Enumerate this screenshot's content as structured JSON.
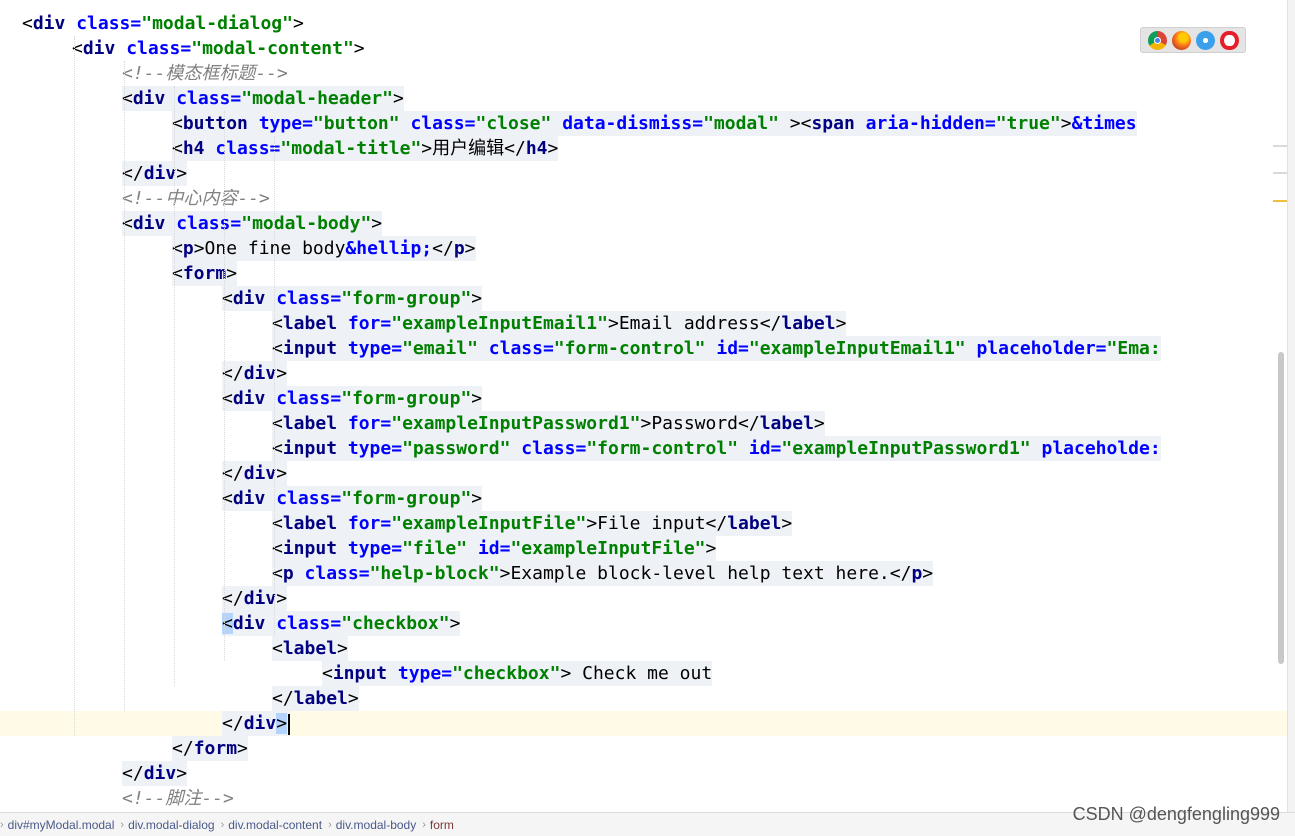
{
  "editor": {
    "lines": [
      {
        "indent": 0,
        "segs": [
          {
            "t": "<",
            "c": "brk"
          },
          {
            "t": "div",
            "c": "tag"
          },
          {
            "t": " ",
            "c": "txt"
          },
          {
            "t": "class=",
            "c": "attr"
          },
          {
            "t": "\"modal-dialog\"",
            "c": "val"
          },
          {
            "t": ">",
            "c": "brk"
          }
        ]
      },
      {
        "indent": 1,
        "segs": [
          {
            "t": "<",
            "c": "brk"
          },
          {
            "t": "div",
            "c": "tag"
          },
          {
            "t": " ",
            "c": "txt"
          },
          {
            "t": "class=",
            "c": "attr"
          },
          {
            "t": "\"modal-content\"",
            "c": "val"
          },
          {
            "t": ">",
            "c": "brk"
          }
        ]
      },
      {
        "indent": 2,
        "segs": [
          {
            "t": "<!--模态框标题-->",
            "c": "cmt"
          }
        ]
      },
      {
        "indent": 2,
        "segs": [
          {
            "t": "<",
            "c": "brk"
          },
          {
            "t": "div",
            "c": "tag"
          },
          {
            "t": " ",
            "c": "txt"
          },
          {
            "t": "class=",
            "c": "attr"
          },
          {
            "t": "\"modal-header\"",
            "c": "val"
          },
          {
            "t": ">",
            "c": "brk"
          }
        ]
      },
      {
        "indent": 3,
        "segs": [
          {
            "t": "<",
            "c": "brk"
          },
          {
            "t": "button",
            "c": "tag"
          },
          {
            "t": " ",
            "c": "txt"
          },
          {
            "t": "type=",
            "c": "attr"
          },
          {
            "t": "\"button\"",
            "c": "val"
          },
          {
            "t": " ",
            "c": "txt"
          },
          {
            "t": "class=",
            "c": "attr"
          },
          {
            "t": "\"close\"",
            "c": "val"
          },
          {
            "t": " ",
            "c": "txt"
          },
          {
            "t": "data-dismiss=",
            "c": "attr"
          },
          {
            "t": "\"modal\"",
            "c": "val"
          },
          {
            "t": " ><",
            "c": "brk"
          },
          {
            "t": "span",
            "c": "tag"
          },
          {
            "t": " ",
            "c": "txt"
          },
          {
            "t": "aria-hidden=",
            "c": "attr"
          },
          {
            "t": "\"true\"",
            "c": "val"
          },
          {
            "t": ">",
            "c": "brk"
          },
          {
            "t": "&times",
            "c": "ent"
          }
        ]
      },
      {
        "indent": 3,
        "segs": [
          {
            "t": "<",
            "c": "brk"
          },
          {
            "t": "h4",
            "c": "tag"
          },
          {
            "t": " ",
            "c": "txt"
          },
          {
            "t": "class=",
            "c": "attr"
          },
          {
            "t": "\"modal-title\"",
            "c": "val"
          },
          {
            "t": ">",
            "c": "brk"
          },
          {
            "t": "用户编辑",
            "c": "txt"
          },
          {
            "t": "</",
            "c": "brk"
          },
          {
            "t": "h4",
            "c": "tag"
          },
          {
            "t": ">",
            "c": "brk"
          }
        ]
      },
      {
        "indent": 2,
        "segs": [
          {
            "t": "</",
            "c": "brk"
          },
          {
            "t": "div",
            "c": "tag"
          },
          {
            "t": ">",
            "c": "brk"
          }
        ]
      },
      {
        "indent": 2,
        "segs": [
          {
            "t": "<!--中心内容-->",
            "c": "cmt"
          }
        ]
      },
      {
        "indent": 2,
        "segs": [
          {
            "t": "<",
            "c": "brk"
          },
          {
            "t": "div",
            "c": "tag"
          },
          {
            "t": " ",
            "c": "txt"
          },
          {
            "t": "class=",
            "c": "attr"
          },
          {
            "t": "\"modal-body\"",
            "c": "val"
          },
          {
            "t": ">",
            "c": "brk"
          }
        ]
      },
      {
        "indent": 3,
        "segs": [
          {
            "t": "<",
            "c": "brk"
          },
          {
            "t": "p",
            "c": "tag"
          },
          {
            "t": ">",
            "c": "brk"
          },
          {
            "t": "One fine body",
            "c": "txt"
          },
          {
            "t": "&hellip;",
            "c": "ent"
          },
          {
            "t": "</",
            "c": "brk"
          },
          {
            "t": "p",
            "c": "tag"
          },
          {
            "t": ">",
            "c": "brk"
          }
        ]
      },
      {
        "indent": 3,
        "segs": [
          {
            "t": "<",
            "c": "brk"
          },
          {
            "t": "form",
            "c": "tag"
          },
          {
            "t": ">",
            "c": "brk"
          }
        ]
      },
      {
        "indent": 4,
        "segs": [
          {
            "t": "<",
            "c": "brk"
          },
          {
            "t": "div",
            "c": "tag"
          },
          {
            "t": " ",
            "c": "txt"
          },
          {
            "t": "class=",
            "c": "attr"
          },
          {
            "t": "\"form-group\"",
            "c": "val"
          },
          {
            "t": ">",
            "c": "brk"
          }
        ]
      },
      {
        "indent": 5,
        "segs": [
          {
            "t": "<",
            "c": "brk"
          },
          {
            "t": "label",
            "c": "tag"
          },
          {
            "t": " ",
            "c": "txt"
          },
          {
            "t": "for=",
            "c": "attr"
          },
          {
            "t": "\"exampleInputEmail1\"",
            "c": "val"
          },
          {
            "t": ">",
            "c": "brk"
          },
          {
            "t": "Email address",
            "c": "txt"
          },
          {
            "t": "</",
            "c": "brk"
          },
          {
            "t": "label",
            "c": "tag"
          },
          {
            "t": ">",
            "c": "brk"
          }
        ]
      },
      {
        "indent": 5,
        "segs": [
          {
            "t": "<",
            "c": "brk"
          },
          {
            "t": "input",
            "c": "tag"
          },
          {
            "t": " ",
            "c": "txt"
          },
          {
            "t": "type=",
            "c": "attr"
          },
          {
            "t": "\"email\"",
            "c": "val"
          },
          {
            "t": " ",
            "c": "txt"
          },
          {
            "t": "class=",
            "c": "attr"
          },
          {
            "t": "\"form-control\"",
            "c": "val"
          },
          {
            "t": " ",
            "c": "txt"
          },
          {
            "t": "id=",
            "c": "attr"
          },
          {
            "t": "\"exampleInputEmail1\"",
            "c": "val"
          },
          {
            "t": " ",
            "c": "txt"
          },
          {
            "t": "placeholder=",
            "c": "attr"
          },
          {
            "t": "\"Ema:",
            "c": "val"
          }
        ]
      },
      {
        "indent": 4,
        "segs": [
          {
            "t": "</",
            "c": "brk"
          },
          {
            "t": "div",
            "c": "tag"
          },
          {
            "t": ">",
            "c": "brk"
          }
        ]
      },
      {
        "indent": 4,
        "segs": [
          {
            "t": "<",
            "c": "brk"
          },
          {
            "t": "div",
            "c": "tag"
          },
          {
            "t": " ",
            "c": "txt"
          },
          {
            "t": "class=",
            "c": "attr"
          },
          {
            "t": "\"form-group\"",
            "c": "val"
          },
          {
            "t": ">",
            "c": "brk"
          }
        ]
      },
      {
        "indent": 5,
        "segs": [
          {
            "t": "<",
            "c": "brk"
          },
          {
            "t": "label",
            "c": "tag"
          },
          {
            "t": " ",
            "c": "txt"
          },
          {
            "t": "for=",
            "c": "attr"
          },
          {
            "t": "\"exampleInputPassword1\"",
            "c": "val"
          },
          {
            "t": ">",
            "c": "brk"
          },
          {
            "t": "Password",
            "c": "txt"
          },
          {
            "t": "</",
            "c": "brk"
          },
          {
            "t": "label",
            "c": "tag"
          },
          {
            "t": ">",
            "c": "brk"
          }
        ]
      },
      {
        "indent": 5,
        "segs": [
          {
            "t": "<",
            "c": "brk"
          },
          {
            "t": "input",
            "c": "tag"
          },
          {
            "t": " ",
            "c": "txt"
          },
          {
            "t": "type=",
            "c": "attr"
          },
          {
            "t": "\"password\"",
            "c": "val"
          },
          {
            "t": " ",
            "c": "txt"
          },
          {
            "t": "class=",
            "c": "attr"
          },
          {
            "t": "\"form-control\"",
            "c": "val"
          },
          {
            "t": " ",
            "c": "txt"
          },
          {
            "t": "id=",
            "c": "attr"
          },
          {
            "t": "\"exampleInputPassword1\"",
            "c": "val"
          },
          {
            "t": " ",
            "c": "txt"
          },
          {
            "t": "placeholde:",
            "c": "attr"
          }
        ]
      },
      {
        "indent": 4,
        "segs": [
          {
            "t": "</",
            "c": "brk"
          },
          {
            "t": "div",
            "c": "tag"
          },
          {
            "t": ">",
            "c": "brk"
          }
        ]
      },
      {
        "indent": 4,
        "segs": [
          {
            "t": "<",
            "c": "brk"
          },
          {
            "t": "div",
            "c": "tag"
          },
          {
            "t": " ",
            "c": "txt"
          },
          {
            "t": "class=",
            "c": "attr"
          },
          {
            "t": "\"form-group\"",
            "c": "val"
          },
          {
            "t": ">",
            "c": "brk"
          }
        ]
      },
      {
        "indent": 5,
        "segs": [
          {
            "t": "<",
            "c": "brk"
          },
          {
            "t": "label",
            "c": "tag"
          },
          {
            "t": " ",
            "c": "txt"
          },
          {
            "t": "for=",
            "c": "attr"
          },
          {
            "t": "\"exampleInputFile\"",
            "c": "val"
          },
          {
            "t": ">",
            "c": "brk"
          },
          {
            "t": "File input",
            "c": "txt"
          },
          {
            "t": "</",
            "c": "brk"
          },
          {
            "t": "label",
            "c": "tag"
          },
          {
            "t": ">",
            "c": "brk"
          }
        ]
      },
      {
        "indent": 5,
        "segs": [
          {
            "t": "<",
            "c": "brk"
          },
          {
            "t": "input",
            "c": "tag"
          },
          {
            "t": " ",
            "c": "txt"
          },
          {
            "t": "type=",
            "c": "attr"
          },
          {
            "t": "\"file\"",
            "c": "val"
          },
          {
            "t": " ",
            "c": "txt"
          },
          {
            "t": "id=",
            "c": "attr"
          },
          {
            "t": "\"exampleInputFile\"",
            "c": "val"
          },
          {
            "t": ">",
            "c": "brk"
          }
        ]
      },
      {
        "indent": 5,
        "segs": [
          {
            "t": "<",
            "c": "brk"
          },
          {
            "t": "p",
            "c": "tag"
          },
          {
            "t": " ",
            "c": "txt"
          },
          {
            "t": "class=",
            "c": "attr"
          },
          {
            "t": "\"help-block\"",
            "c": "val"
          },
          {
            "t": ">",
            "c": "brk"
          },
          {
            "t": "Example block-level help text here.",
            "c": "txt"
          },
          {
            "t": "</",
            "c": "brk"
          },
          {
            "t": "p",
            "c": "tag"
          },
          {
            "t": ">",
            "c": "brk"
          }
        ]
      },
      {
        "indent": 4,
        "segs": [
          {
            "t": "</",
            "c": "brk"
          },
          {
            "t": "div",
            "c": "tag"
          },
          {
            "t": ">",
            "c": "brk"
          }
        ]
      },
      {
        "indent": 4,
        "segs": [
          {
            "t": "<",
            "c": "brk matchbr"
          },
          {
            "t": "div",
            "c": "tag"
          },
          {
            "t": " ",
            "c": "txt"
          },
          {
            "t": "class=",
            "c": "attr"
          },
          {
            "t": "\"checkbox\"",
            "c": "val"
          },
          {
            "t": ">",
            "c": "brk"
          }
        ]
      },
      {
        "indent": 5,
        "segs": [
          {
            "t": "<",
            "c": "brk"
          },
          {
            "t": "label",
            "c": "tag"
          },
          {
            "t": ">",
            "c": "brk"
          }
        ]
      },
      {
        "indent": 6,
        "segs": [
          {
            "t": "<",
            "c": "brk"
          },
          {
            "t": "input",
            "c": "tag"
          },
          {
            "t": " ",
            "c": "txt"
          },
          {
            "t": "type=",
            "c": "attr"
          },
          {
            "t": "\"checkbox\"",
            "c": "val"
          },
          {
            "t": ">",
            "c": "brk"
          },
          {
            "t": " Check me out",
            "c": "txt"
          }
        ]
      },
      {
        "indent": 5,
        "segs": [
          {
            "t": "</",
            "c": "brk"
          },
          {
            "t": "label",
            "c": "tag"
          },
          {
            "t": ">",
            "c": "brk"
          }
        ]
      },
      {
        "indent": 4,
        "current": true,
        "segs": [
          {
            "t": "</",
            "c": "brk"
          },
          {
            "t": "div",
            "c": "tag"
          },
          {
            "t": ">",
            "c": "brk matchbr"
          }
        ]
      },
      {
        "indent": 3,
        "segs": [
          {
            "t": "</",
            "c": "brk"
          },
          {
            "t": "form",
            "c": "tag"
          },
          {
            "t": ">",
            "c": "brk"
          }
        ]
      },
      {
        "indent": 2,
        "segs": [
          {
            "t": "</",
            "c": "brk"
          },
          {
            "t": "div",
            "c": "tag"
          },
          {
            "t": ">",
            "c": "brk"
          }
        ]
      },
      {
        "indent": 2,
        "segs": [
          {
            "t": "<!--脚注-->",
            "c": "cmt"
          }
        ]
      }
    ],
    "caret_line": 28
  },
  "browser_preview": {
    "icons": [
      "chrome-icon",
      "firefox-icon",
      "safari-icon",
      "opera-icon"
    ]
  },
  "breadcrumb": {
    "items": [
      "div#myModal.modal",
      "div.modal-dialog",
      "div.modal-content",
      "div.modal-body",
      "form"
    ]
  },
  "watermark": "CSDN @dengfengling999",
  "colors": {
    "tag": "#000080",
    "attribute": "#0000ff",
    "value": "#008000",
    "comment": "#808080",
    "current_line": "#fffbe6"
  }
}
